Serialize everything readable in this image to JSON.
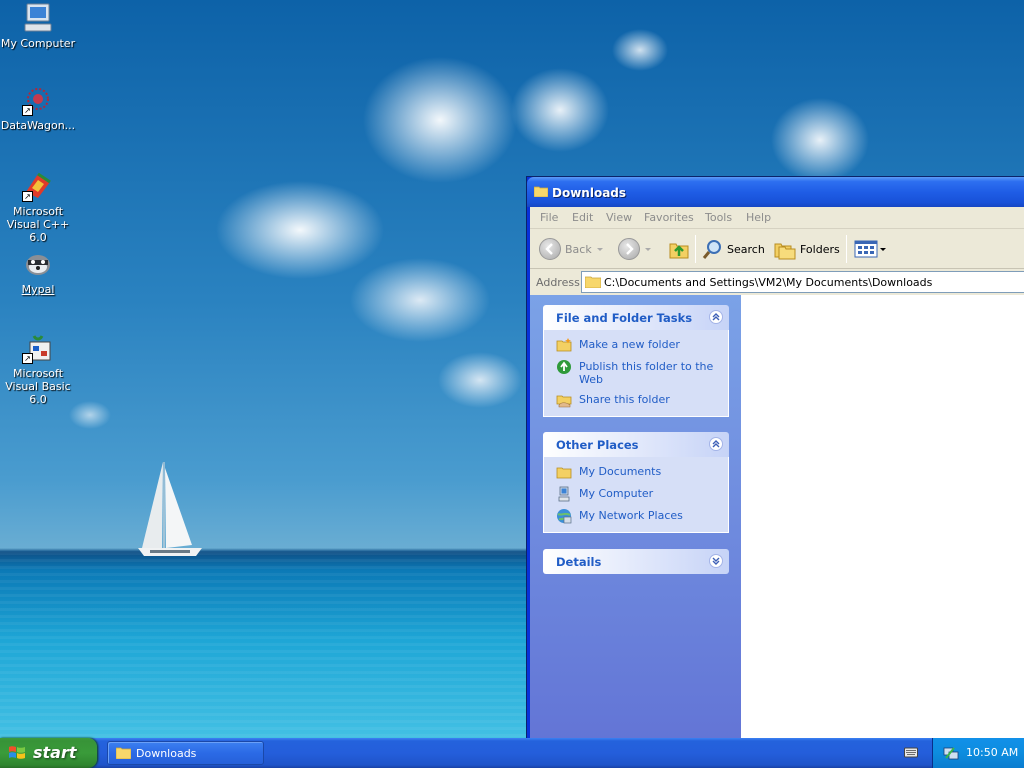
{
  "desktop": {
    "icons": [
      {
        "label": "My Computer",
        "icon": "my-computer-icon"
      },
      {
        "label": "DataWagon...",
        "icon": "datawagon-icon"
      },
      {
        "label": "Microsoft Visual C++ 6.0",
        "icon": "visual-cpp-icon"
      },
      {
        "label": "Mypal",
        "icon": "mypal-icon"
      },
      {
        "label": "Microsoft Visual Basic 6.0",
        "icon": "visual-basic-icon"
      }
    ]
  },
  "window": {
    "title": "Downloads",
    "menu": [
      "File",
      "Edit",
      "View",
      "Favorites",
      "Tools",
      "Help"
    ],
    "toolbar": {
      "back_label": "Back",
      "search_label": "Search",
      "folders_label": "Folders"
    },
    "address": {
      "label": "Address",
      "value": "C:\\Documents and Settings\\VM2\\My Documents\\Downloads"
    },
    "taskpane": {
      "file_folder_tasks": {
        "title": "File and Folder Tasks",
        "links": [
          "Make a new folder",
          "Publish this folder to the Web",
          "Share this folder"
        ]
      },
      "other_places": {
        "title": "Other Places",
        "links": [
          "My Documents",
          "My Computer",
          "My Network Places"
        ]
      },
      "details": {
        "title": "Details"
      }
    }
  },
  "taskbar": {
    "start_label": "start",
    "task_button_label": "Downloads",
    "clock": "10:50 AM"
  },
  "colors": {
    "taskpane_link": "#215dc6",
    "titlebar": "#1f5de6",
    "start_green": "#3a9b3a",
    "taskbar_blue": "#245edb"
  }
}
